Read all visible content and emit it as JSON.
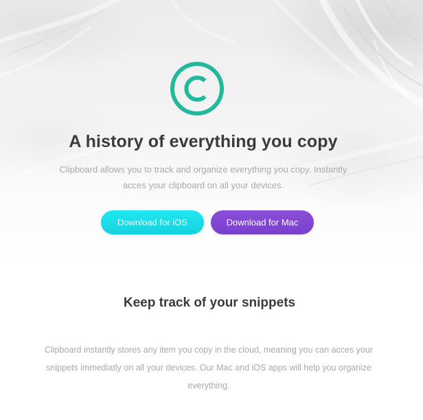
{
  "hero": {
    "logo_icon": "copyright-circle-icon",
    "logo_color": "#22b99a",
    "title": "A history of everything you copy",
    "description": "Clipboard allows you to track and organize everything you copy. Instantly acces your clipboard on all your devices.",
    "buttons": {
      "ios_label": "Download for iOS",
      "ios_color": "#1de0ec",
      "mac_label": "Download for Mac",
      "mac_color": "#8448d4"
    }
  },
  "features": {
    "title": "Keep track of your snippets",
    "description": "Clipboard instantly stores any item you copy in the cloud, meaning you can acces your snippets immediatly on all your devices. Our Mac and iOS apps will help you organize everything."
  }
}
